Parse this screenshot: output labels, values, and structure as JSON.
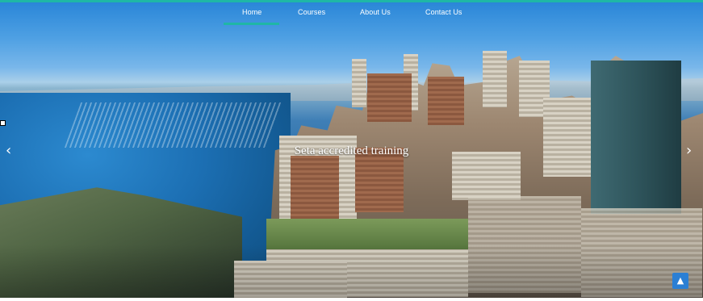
{
  "nav": {
    "items": [
      {
        "label": "Home",
        "active": true
      },
      {
        "label": "Courses",
        "active": false
      },
      {
        "label": "About Us",
        "active": false
      },
      {
        "label": "Contact Us",
        "active": false
      }
    ]
  },
  "hero": {
    "caption": "Seta accredited training",
    "prev_icon": "chevron-left-icon",
    "next_icon": "chevron-right-icon"
  },
  "scroll_top": {
    "icon": "chevron-up-icon"
  },
  "colors": {
    "accent": "#1fb7a6",
    "scroll_button": "#2b7fd4"
  }
}
